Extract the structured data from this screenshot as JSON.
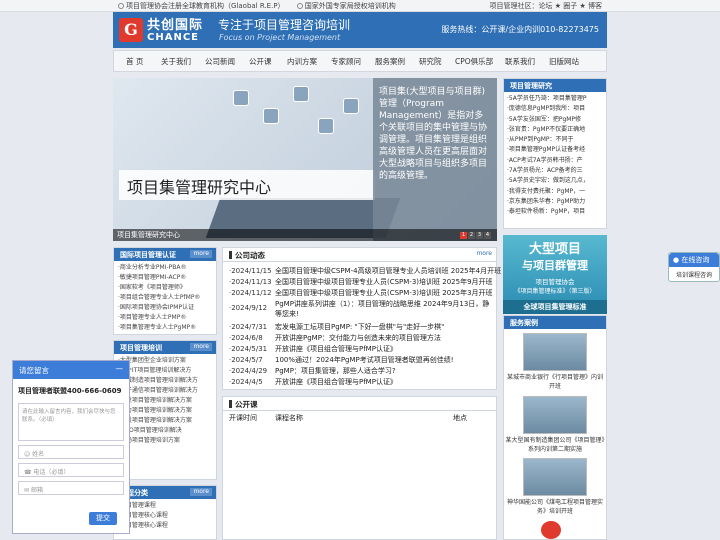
{
  "topbar": {
    "left1": "项目管理协会注册全球教育机构（Glaobal R.E.P）",
    "left2": "国家外国专家局授权培训机构",
    "right": "项目管理社区：论坛 ★ 圈子 ★ 博客"
  },
  "header": {
    "logo_mark": "G",
    "logo_cn": "共创国际",
    "logo_en": "CHANCE",
    "slogan_cn": "专注于项目管理咨询培训",
    "slogan_en": "Focus on Project Management",
    "hotline": "服务热线：公开课/企业内训010-82273475"
  },
  "nav": [
    "首 页",
    "关于我们",
    "公司新闻",
    "公开课",
    "内训方案",
    "专家顾问",
    "服务案例",
    "研究院",
    "CPO俱乐部",
    "联系我们",
    "旧版网站"
  ],
  "banner": {
    "title": "项目集管理研究中心",
    "text": "项目集(大型项目与项目群)管理（Program Management）是指对多个关联项目的集中管理与协调管理。项目集管理是组织高级管理人员在更高层面对大型战略项目与组织多项目的高级管理。",
    "caption": "项目集管理研究中心",
    "pages": [
      "1",
      "2",
      "3",
      "4"
    ]
  },
  "left_panels": {
    "cert": {
      "title": "国际项目管理认证",
      "more": "more",
      "items": [
        "·商业分析专业PMI-PBA®",
        "·敏捷项目管理PMI-ACP®",
        "·国家软考《项目管理师》",
        "·项目组合管理专业人士PfMP®",
        "·国际项目管理协会IPMP认证",
        "·项目管理专业人士PMP®",
        "·项目集管理专业人士PgMP®"
      ]
    },
    "training": {
      "title": "项目管理培训",
      "more": "more",
      "items": [
        "·大型集团型企业培训方案",
        "·软件IT项目管理培训解决方",
        "·机械制造项目管理培训解决方",
        "·电子通信项目管理培训解决方",
        "·研发项目管理培训解决方案",
        "·电力项目管理培训解决方案",
        "·建设项目管理培训解决方案",
        "·NGO项目管理培训解决",
        "·市场项目管理培训方案"
      ]
    },
    "category": {
      "title": "课程分类",
      "more": "more",
      "items": [
        "·项目管理课程",
        "·项目管理核心课程",
        "·项目管理核心课程"
      ]
    }
  },
  "news": {
    "title": "公司动态",
    "more": "more",
    "items": [
      {
        "date": "·2024/11/15",
        "text": "全国项目管理中级CSPM-4高级项目管理专业人员培训班 2025年4月开班"
      },
      {
        "date": "·2024/11/13",
        "text": "全国项目管理中级项目管理专业人员(CSPM-3)培训班 2025年9月开班"
      },
      {
        "date": "·2024/11/12",
        "text": "全国项目管理中级项目管理专业人员(CSPM-3)培训班 2025年3月开班"
      },
      {
        "date": "·2024/9/12",
        "text": "PgMP讲座系列讲座（1）：项目管理的战略思维 2024年9月13日，静等您来!"
      },
      {
        "date": "·2024/7/31",
        "text": "宏发电源工坛项目PgMP: \"下好一盘棋\"与\"走好一步棋\""
      },
      {
        "date": "·2024/6/8",
        "text": "开放讲座PgMP：交付能力与创造未来的项目管理方法"
      },
      {
        "date": "·2024/5/31",
        "text": "开放讲座《项目组合管理与PfMP认证》"
      },
      {
        "date": "·2024/5/7",
        "text": "100%通过！2024年PgMP考试项目管理者联盟再创佳绩!"
      },
      {
        "date": "·2024/4/29",
        "text": "PgMP：项目集管理，那些人适合学习?"
      },
      {
        "date": "·2024/4/5",
        "text": "开放讲座《项目组合管理与PfMP认证》"
      }
    ]
  },
  "course": {
    "title": "公开课",
    "col_time": "开课时间",
    "col_name": "课程名称",
    "col_place": "地点"
  },
  "research": {
    "title": "项目管理研究",
    "items": [
      "·5A学员任乃琦：项目集管理P",
      "·庞德信息PgMP到我所：项目",
      "·5A学友张国军：把PgMP修",
      "·张官贵：PgMP不仅要正确地",
      "·从PMP到PgMP：不同于",
      "·项目集管理PgMP认证备考经",
      "·ACP考试7A学员韩书扬：产",
      "·7A学员杨光：ACP备考的三",
      "·5A学员史宇宏：做到这几点，",
      "·我得支付费托聚：PgMP，一",
      "·京东集团朱华春：PgMP助力",
      "·泰坦软件杨新：PgMP，项目"
    ]
  },
  "promo": {
    "line1": "大型项目",
    "line2": "与项目群管理",
    "line3": "项目管理协会",
    "line4": "《项目集管理标准》（第三版）",
    "line5": "全球项目集管理标准"
  },
  "cases": {
    "title": "服务案例",
    "items": [
      "某城市商业银行《行项目管理》内训开班",
      "某大型国有制造集团公司《项目管理》系列内训第二期实施",
      "神华国能公司《煤电工程项目管理实务》培训开班"
    ]
  },
  "chat": {
    "title": "在线咨询",
    "btn": "培训课程咨询"
  },
  "message": {
    "title": "请您留言",
    "close": "—",
    "phone": "项目管理者联盟400-666-0609",
    "placeholder": "请在此输入留言内容，我们会尽快与您联系。（必填）",
    "name": "姓名",
    "tel": "电话（必填）",
    "email": "邮箱",
    "send": "提交"
  },
  "colors": {
    "brand_blue": "#2e6fb5",
    "accent_red": "#e03a2f"
  }
}
